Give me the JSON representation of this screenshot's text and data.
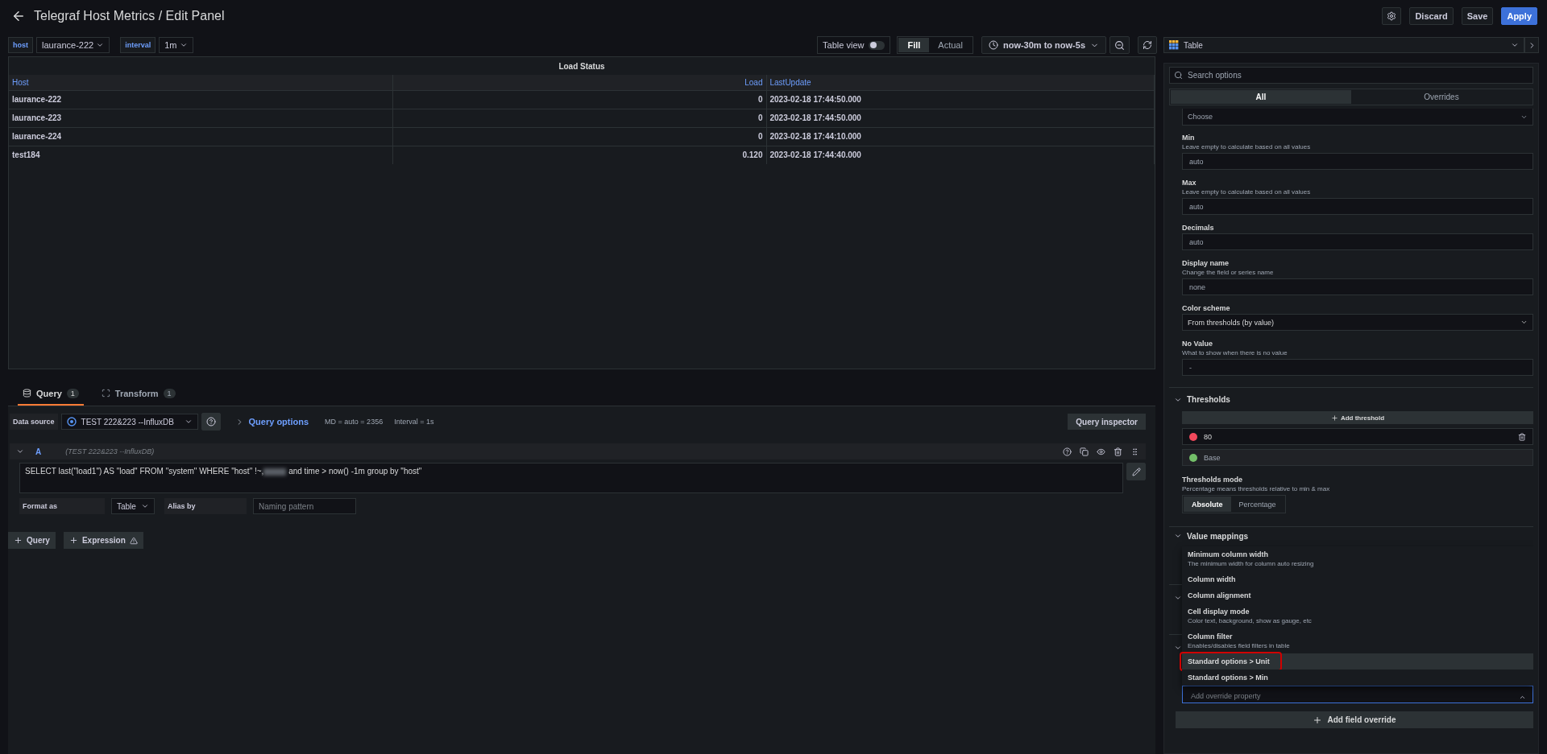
{
  "header": {
    "title": "Telegraf Host Metrics / Edit Panel",
    "buttons": [
      {
        "label": "Discard",
        "kind": "secondary"
      },
      {
        "label": "Save",
        "kind": "secondary"
      },
      {
        "label": "Apply",
        "kind": "primary"
      }
    ]
  },
  "variables": [
    {
      "name": "host",
      "value": "laurance-222"
    },
    {
      "name": "interval",
      "value": "1m"
    }
  ],
  "toolbar": {
    "table_view": {
      "label": "Table view",
      "on": false
    },
    "size_modes": [
      {
        "label": "Fill",
        "selected": true
      },
      {
        "label": "Actual",
        "selected": false
      }
    ],
    "time_range": "now-30m to now-5s"
  },
  "visualization": {
    "label": "Table"
  },
  "panel": {
    "title": "Load Status",
    "columns": [
      {
        "label": "Host"
      },
      {
        "label": "Load"
      },
      {
        "label": "LastUpdate"
      }
    ],
    "rows": [
      [
        "laurance-222",
        "0",
        "2023-02-18 17:44:50.000"
      ],
      [
        "laurance-223",
        "0",
        "2023-02-18 17:44:50.000"
      ],
      [
        "laurance-224",
        "0",
        "2023-02-18 17:44:10.000"
      ],
      [
        "test184",
        "0.120",
        "2023-02-18 17:44:40.000"
      ]
    ]
  },
  "query_tabs": [
    {
      "label": "Query",
      "count": "1",
      "selected": true
    },
    {
      "label": "Transform",
      "count": "1",
      "selected": false
    }
  ],
  "data_source": {
    "label": "Data source",
    "value": "TEST 222&223 --InfluxDB",
    "options_label": "Query options",
    "md": "MD = auto = 2356",
    "interval": "Interval = 1s",
    "inspector": "Query inspector"
  },
  "query": {
    "ref": "A",
    "source": "(TEST 222&223 --InfluxDB)",
    "text_before": "SELECT last(\"load1\") AS \"load\" FROM \"system\" WHERE  \"host\" !~,",
    "text_after": " and time > now() -1m group by \"host\"",
    "format_label": "Format as",
    "format_value": "Table",
    "alias_label": "Alias by",
    "alias_placeholder": "Naming pattern"
  },
  "add_buttons": [
    {
      "label": "Query",
      "warning": false
    },
    {
      "label": "Expression",
      "warning": true
    }
  ],
  "options": {
    "search_placeholder": "Search options",
    "tabs": [
      {
        "label": "All",
        "selected": true
      },
      {
        "label": "Overrides",
        "selected": false
      }
    ],
    "choose_placeholder": "Choose",
    "fields": [
      {
        "kind": "input",
        "label": "Min",
        "description": "Leave empty to calculate based on all values",
        "placeholder": "auto"
      },
      {
        "kind": "input",
        "label": "Max",
        "description": "Leave empty to calculate based on all values",
        "placeholder": "auto"
      },
      {
        "kind": "input",
        "label": "Decimals",
        "placeholder": "auto"
      },
      {
        "kind": "input",
        "label": "Display name",
        "description": "Change the field or series name",
        "placeholder": "none"
      },
      {
        "kind": "select",
        "label": "Color scheme",
        "value": "From thresholds (by value)"
      },
      {
        "kind": "input",
        "label": "No Value",
        "description": "What to show when there is no value",
        "placeholder": "-"
      }
    ]
  },
  "thresholds": {
    "title": "Thresholds",
    "add_label": "Add threshold",
    "steps": [
      {
        "kind": "input",
        "value": "80",
        "color": "#f2495c"
      },
      {
        "kind": "base",
        "value": "Base",
        "color": "#73bf69"
      }
    ],
    "mode_label": "Thresholds mode",
    "mode_description": "Percentage means thresholds relative to min & max",
    "modes": [
      {
        "label": "Absolute",
        "selected": true
      },
      {
        "label": "Percentage",
        "selected": false
      }
    ]
  },
  "value_mappings": {
    "title": "Value mappings"
  },
  "override_menu": [
    {
      "label": "Minimum column width",
      "description": "The minimum width for column auto resizing",
      "highlighted": false,
      "circled": false
    },
    {
      "label": "Column width",
      "highlighted": false,
      "circled": false
    },
    {
      "label": "Column alignment",
      "highlighted": false,
      "circled": false
    },
    {
      "label": "Cell display mode",
      "description": "Color text, background, show as gauge, etc",
      "highlighted": false,
      "circled": false
    },
    {
      "label": "Column filter",
      "description": "Enables/disables field filters in table",
      "highlighted": false,
      "circled": false
    },
    {
      "label": "Standard options > Unit",
      "highlighted": true,
      "circled": true
    },
    {
      "label": "Standard options > Min",
      "highlighted": false,
      "circled": false
    }
  ],
  "override_field": {
    "placeholder": "Add override property"
  },
  "add_field_override": "Add field override"
}
